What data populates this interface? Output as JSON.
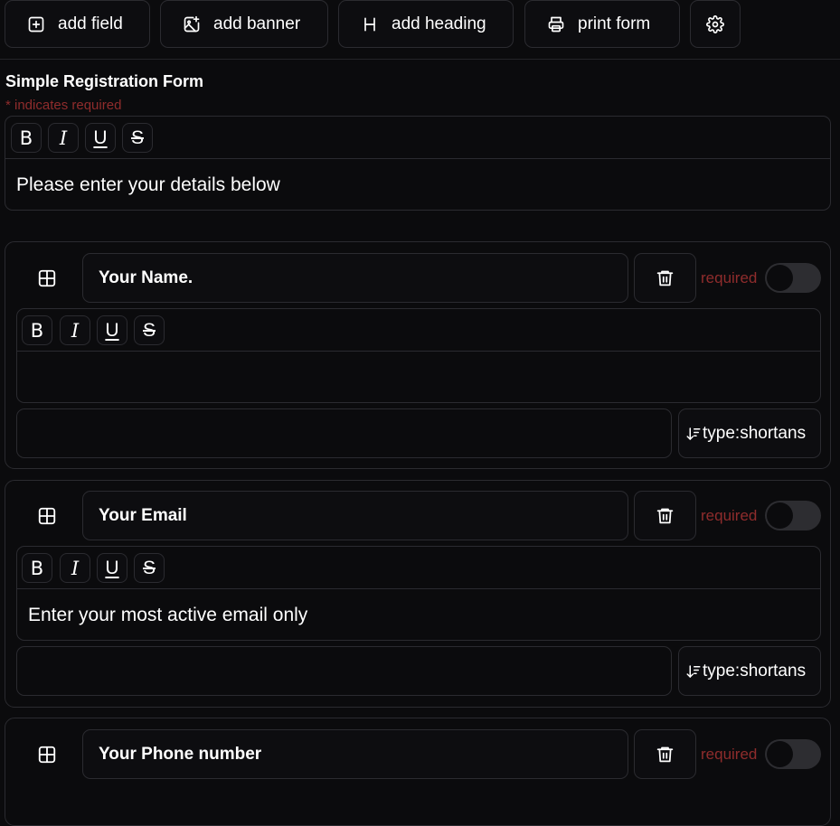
{
  "toolbar": {
    "add_field": "add field",
    "add_banner": "add banner",
    "add_heading": "add heading",
    "print_form": "print form"
  },
  "form": {
    "title": "Simple Registration Form",
    "required_note": "* indicates required",
    "description": "Please enter your details below"
  },
  "format_buttons": {
    "bold": "B",
    "italic": "I",
    "underline": "U",
    "strike": "S"
  },
  "fields": [
    {
      "label": "Your Name.",
      "description": "",
      "required_label": "required",
      "required": false,
      "type_label": "type:shortans"
    },
    {
      "label": "Your Email",
      "description": "Enter your most active email only",
      "required_label": "required",
      "required": false,
      "type_label": "type:shortans"
    },
    {
      "label": "Your Phone number",
      "required_label": "required",
      "required": false
    }
  ],
  "icons": {
    "add_field": "plus-square-icon",
    "add_banner": "image-plus-icon",
    "add_heading": "heading-icon",
    "print_form": "printer-icon",
    "settings": "gear-icon",
    "field_handle": "grid-icon",
    "delete": "trash-icon",
    "type": "sort-down-icon"
  },
  "colors": {
    "background": "#0b0b0d",
    "border": "#2b2b30",
    "required_text": "#8f2c2c",
    "toggle_off": "#2d2d31"
  }
}
